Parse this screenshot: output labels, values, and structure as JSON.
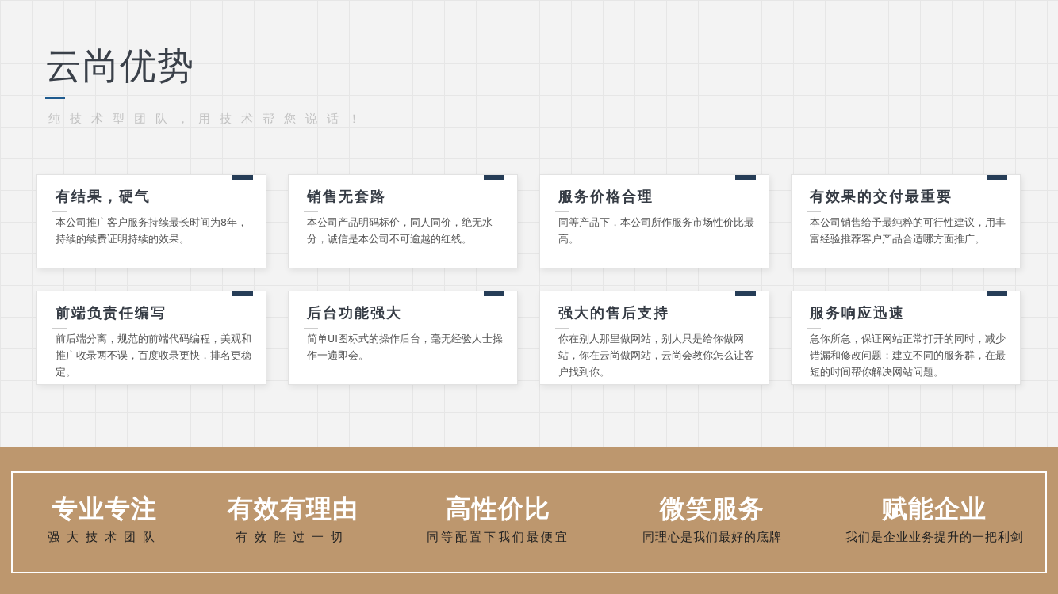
{
  "header": {
    "title": "云尚优势",
    "subtitle": "纯技术型团队，用技术帮您说话！"
  },
  "cards": [
    {
      "title": "有结果，硬气",
      "text": "本公司推广客户服务持续最长时间为8年，持续的续费证明持续的效果。"
    },
    {
      "title": "销售无套路",
      "text": "本公司产品明码标价，同人同价，绝无水分，诚信是本公司不可逾越的红线。"
    },
    {
      "title": "服务价格合理",
      "text": "同等产品下，本公司所作服务市场性价比最高。"
    },
    {
      "title": "有效果的交付最重要",
      "text": "本公司销售给予最纯粹的可行性建议，用丰富经验推荐客户产品合适哪方面推广。"
    },
    {
      "title": "前端负责任编写",
      "text": "前后端分离，规范的前端代码编程，美观和推广收录两不误，百度收录更快，排名更稳定。"
    },
    {
      "title": "后台功能强大",
      "text": "简单UI图标式的操作后台，毫无经验人士操作一遍即会。"
    },
    {
      "title": "强大的售后支持",
      "text": "你在别人那里做网站，别人只是给你做网站，你在云尚做网站，云尚会教你怎么让客户找到你。"
    },
    {
      "title": "服务响应迅速",
      "text": "急你所急，保证网站正常打开的同时，减少错漏和修改问题；建立不同的服务群，在最短的时间帮你解决网站问题。"
    }
  ],
  "features": [
    {
      "title": "专业专注",
      "subtitle": "强大技术团队"
    },
    {
      "title": "有效有理由",
      "subtitle": "有效胜过一切"
    },
    {
      "title": "高性价比",
      "subtitle": "同等配置下我们最便宜"
    },
    {
      "title": "微笑服务",
      "subtitle": "同理心是我们最好的底牌"
    },
    {
      "title": "赋能企业",
      "subtitle": "我们是企业业务提升的一把利剑"
    }
  ]
}
